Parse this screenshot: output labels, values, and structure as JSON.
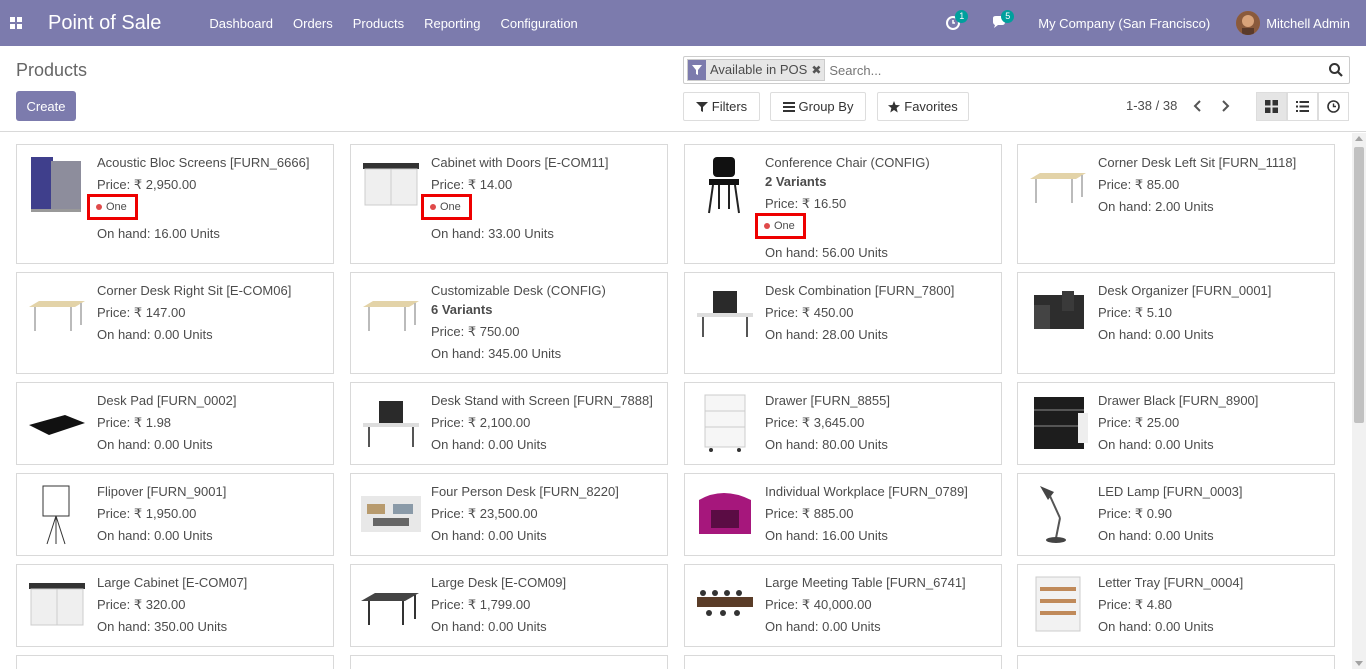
{
  "navbar": {
    "app_title": "Point of Sale",
    "menu": [
      "Dashboard",
      "Orders",
      "Products",
      "Reporting",
      "Configuration"
    ],
    "activity_count": "1",
    "messages_count": "5",
    "company": "My Company (San Francisco)",
    "user": "Mitchell Admin"
  },
  "control_panel": {
    "breadcrumb": "Products",
    "create_label": "Create",
    "facet_label": "Available in POS",
    "search_placeholder": "Search...",
    "filters_label": "Filters",
    "group_by_label": "Group By",
    "favorites_label": "Favorites",
    "pager": "1-38 / 38"
  },
  "products": [
    {
      "name": "Acoustic Bloc Screens [FURN_6666]",
      "variants": "",
      "price": "Price: ₹ 2,950.00",
      "tag": "One",
      "on_hand": "On hand: 16.00 Units",
      "icon": "acoustic-screen"
    },
    {
      "name": "Cabinet with Doors [E-COM11]",
      "variants": "",
      "price": "Price: ₹ 14.00",
      "tag": "One",
      "on_hand": "On hand: 33.00 Units",
      "icon": "cabinet"
    },
    {
      "name": "Conference Chair (CONFIG)",
      "variants": "2 Variants",
      "price": "Price: ₹ 16.50",
      "tag": "One",
      "on_hand": "On hand: 56.00 Units",
      "icon": "chair"
    },
    {
      "name": "Corner Desk Left Sit [FURN_1118]",
      "variants": "",
      "price": "Price: ₹ 85.00",
      "tag": "",
      "on_hand": "On hand: 2.00 Units",
      "icon": "desk"
    },
    {
      "name": "Corner Desk Right Sit [E-COM06]",
      "variants": "",
      "price": "Price: ₹ 147.00",
      "tag": "",
      "on_hand": "On hand: 0.00 Units",
      "icon": "desk"
    },
    {
      "name": "Customizable Desk (CONFIG)",
      "variants": "6 Variants",
      "price": "Price: ₹ 750.00",
      "tag": "",
      "on_hand": "On hand: 345.00 Units",
      "icon": "desk"
    },
    {
      "name": "Desk Combination [FURN_7800]",
      "variants": "",
      "price": "Price: ₹ 450.00",
      "tag": "",
      "on_hand": "On hand: 28.00 Units",
      "icon": "desk-combo"
    },
    {
      "name": "Desk Organizer [FURN_0001]",
      "variants": "",
      "price": "Price: ₹ 5.10",
      "tag": "",
      "on_hand": "On hand: 0.00 Units",
      "icon": "organizer"
    },
    {
      "name": "Desk Pad [FURN_0002]",
      "variants": "",
      "price": "Price: ₹ 1.98",
      "tag": "",
      "on_hand": "On hand: 0.00 Units",
      "icon": "pad"
    },
    {
      "name": "Desk Stand with Screen [FURN_7888]",
      "variants": "",
      "price": "Price: ₹ 2,100.00",
      "tag": "",
      "on_hand": "On hand: 0.00 Units",
      "icon": "desk-combo"
    },
    {
      "name": "Drawer [FURN_8855]",
      "variants": "",
      "price": "Price: ₹ 3,645.00",
      "tag": "",
      "on_hand": "On hand: 80.00 Units",
      "icon": "drawer"
    },
    {
      "name": "Drawer Black [FURN_8900]",
      "variants": "",
      "price": "Price: ₹ 25.00",
      "tag": "",
      "on_hand": "On hand: 0.00 Units",
      "icon": "drawer-black"
    },
    {
      "name": "Flipover [FURN_9001]",
      "variants": "",
      "price": "Price: ₹ 1,950.00",
      "tag": "",
      "on_hand": "On hand: 0.00 Units",
      "icon": "flipover"
    },
    {
      "name": "Four Person Desk [FURN_8220]",
      "variants": "",
      "price": "Price: ₹ 23,500.00",
      "tag": "",
      "on_hand": "On hand: 0.00 Units",
      "icon": "office"
    },
    {
      "name": "Individual Workplace [FURN_0789]",
      "variants": "",
      "price": "Price: ₹ 885.00",
      "tag": "",
      "on_hand": "On hand: 16.00 Units",
      "icon": "workplace"
    },
    {
      "name": "LED Lamp [FURN_0003]",
      "variants": "",
      "price": "Price: ₹ 0.90",
      "tag": "",
      "on_hand": "On hand: 0.00 Units",
      "icon": "lamp"
    },
    {
      "name": "Large Cabinet [E-COM07]",
      "variants": "",
      "price": "Price: ₹ 320.00",
      "tag": "",
      "on_hand": "On hand: 350.00 Units",
      "icon": "cabinet"
    },
    {
      "name": "Large Desk [E-COM09]",
      "variants": "",
      "price": "Price: ₹ 1,799.00",
      "tag": "",
      "on_hand": "On hand: 0.00 Units",
      "icon": "desk-dark"
    },
    {
      "name": "Large Meeting Table [FURN_6741]",
      "variants": "",
      "price": "Price: ₹ 40,000.00",
      "tag": "",
      "on_hand": "On hand: 0.00 Units",
      "icon": "meeting-table"
    },
    {
      "name": "Letter Tray [FURN_0004]",
      "variants": "",
      "price": "Price: ₹ 4.80",
      "tag": "",
      "on_hand": "On hand: 0.00 Units",
      "icon": "letter-tray"
    }
  ]
}
